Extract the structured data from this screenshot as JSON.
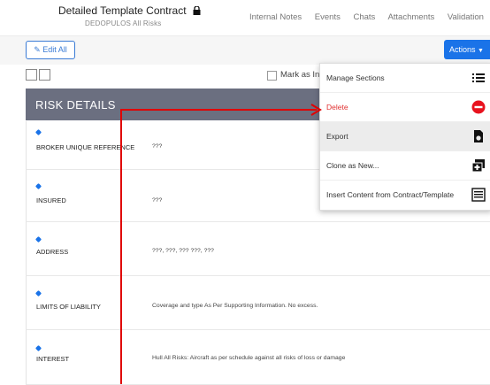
{
  "header": {
    "title": "Detailed Template Contract",
    "subtitle": "DEDOPULOS All Risks",
    "nav": [
      "Internal Notes",
      "Events",
      "Chats",
      "Attachments",
      "Validation"
    ]
  },
  "toolbar": {
    "edit_all_label": "Edit All",
    "actions_label": "Actions",
    "mark_label": "Mark as Incomplete"
  },
  "section": {
    "title": "RISK DETAILS"
  },
  "rows": [
    {
      "label": "BROKER UNIQUE REFERENCE",
      "value": "???"
    },
    {
      "label": "INSURED",
      "value": "???"
    },
    {
      "label": "ADDRESS",
      "value": "???, ???, ??? ???, ???"
    },
    {
      "label": "LIMITS OF LIABILITY",
      "value": "Coverage and type As Per Supporting Information. No excess."
    },
    {
      "label": "INTEREST",
      "value": "Hull All Risks: Aircraft as per schedule against all risks of loss or damage"
    }
  ],
  "actions_menu": [
    {
      "label": "Manage Sections",
      "icon": "list-icon"
    },
    {
      "label": "Delete",
      "icon": "minus-circle-icon",
      "color": "#e03030"
    },
    {
      "label": "Export",
      "icon": "file-export-icon",
      "highlighted": true
    },
    {
      "label": "Clone as New...",
      "icon": "clone-icon"
    },
    {
      "label": "Insert Content from Contract/Template",
      "icon": "insert-content-icon"
    }
  ],
  "colors": {
    "accent": "#1a73e8",
    "header_band": "#6b6f80",
    "annotation": "#e00000"
  }
}
